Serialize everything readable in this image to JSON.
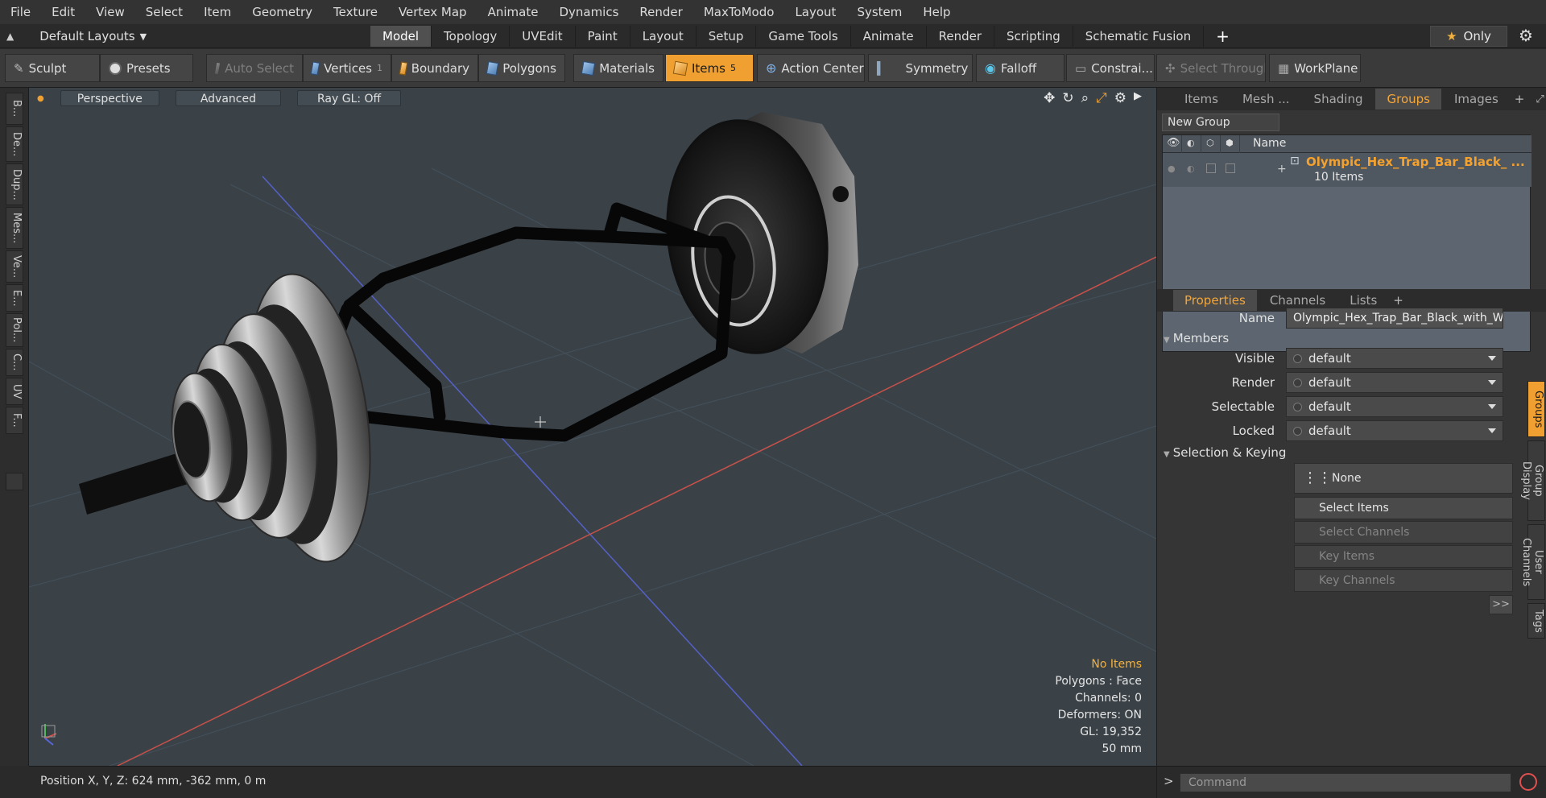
{
  "menu": [
    "File",
    "Edit",
    "View",
    "Select",
    "Item",
    "Geometry",
    "Texture",
    "Vertex Map",
    "Animate",
    "Dynamics",
    "Render",
    "MaxToModo",
    "Layout",
    "System",
    "Help"
  ],
  "layout_selector": "Default Layouts",
  "layout_tabs": [
    {
      "label": "Model",
      "active": true
    },
    {
      "label": "Topology"
    },
    {
      "label": "UVEdit"
    },
    {
      "label": "Paint"
    },
    {
      "label": "Layout"
    },
    {
      "label": "Setup"
    },
    {
      "label": "Game Tools"
    },
    {
      "label": "Animate"
    },
    {
      "label": "Render"
    },
    {
      "label": "Scripting"
    },
    {
      "label": "Schematic Fusion"
    }
  ],
  "plus": "+",
  "only_label": "Only",
  "toolbar": {
    "sculpt": "Sculpt",
    "presets": "Presets",
    "auto_select": "Auto Select",
    "vertices": "Vertices",
    "vertices_count": "1",
    "boundary": "Boundary",
    "polygons": "Polygons",
    "materials": "Materials",
    "items": "Items",
    "items_count": "5",
    "action_center": "Action Center",
    "symmetry": "Symmetry",
    "falloff": "Falloff",
    "constraints": "Constrai...",
    "select_through": "Select Through",
    "workplane": "WorkPlane"
  },
  "left_tabs": [
    "B...",
    "De...",
    "Dup...",
    "Mes...",
    "Ve...",
    "E...",
    "Pol...",
    "C...",
    "UV",
    "F..."
  ],
  "viewport": {
    "view": "Perspective",
    "mode": "Advanced",
    "raygl": "Ray GL: Off",
    "info": {
      "items": "No Items",
      "polygons": "Polygons : Face",
      "channels": "Channels: 0",
      "deformers": "Deformers: ON",
      "gl": "GL: 19,352",
      "scale": "50 mm"
    }
  },
  "status": "Position X, Y, Z:   624 mm, -362 mm, 0 m",
  "right_top_tabs": [
    {
      "label": "Items"
    },
    {
      "label": "Mesh ..."
    },
    {
      "label": "Shading"
    },
    {
      "label": "Groups",
      "active": true
    },
    {
      "label": "Images"
    }
  ],
  "groups": {
    "new_group": "New Group",
    "col_name": "Name",
    "item_name": "Olympic_Hex_Trap_Bar_Black_ ...",
    "item_count": "10 Items"
  },
  "props_tabs": [
    {
      "label": "Properties",
      "active": true
    },
    {
      "label": "Channels"
    },
    {
      "label": "Lists"
    }
  ],
  "properties": {
    "name_label": "Name",
    "name_value": "Olympic_Hex_Trap_Bar_Black_with_W",
    "members": "Members",
    "visible_label": "Visible",
    "visible_value": "default",
    "render_label": "Render",
    "render_value": "default",
    "selectable_label": "Selectable",
    "selectable_value": "default",
    "locked_label": "Locked",
    "locked_value": "default",
    "sel_keying": "Selection & Keying",
    "none": "None",
    "select_items": "Select Items",
    "select_channels": "Select Channels",
    "key_items": "Key Items",
    "key_channels": "Key Channels",
    "more": ">>"
  },
  "right_vtabs": [
    {
      "label": "Groups",
      "active": true
    },
    {
      "label": "Group Display"
    },
    {
      "label": "User Channels"
    },
    {
      "label": "Tags"
    }
  ],
  "command_placeholder": "Command",
  "command_prompt": ">"
}
